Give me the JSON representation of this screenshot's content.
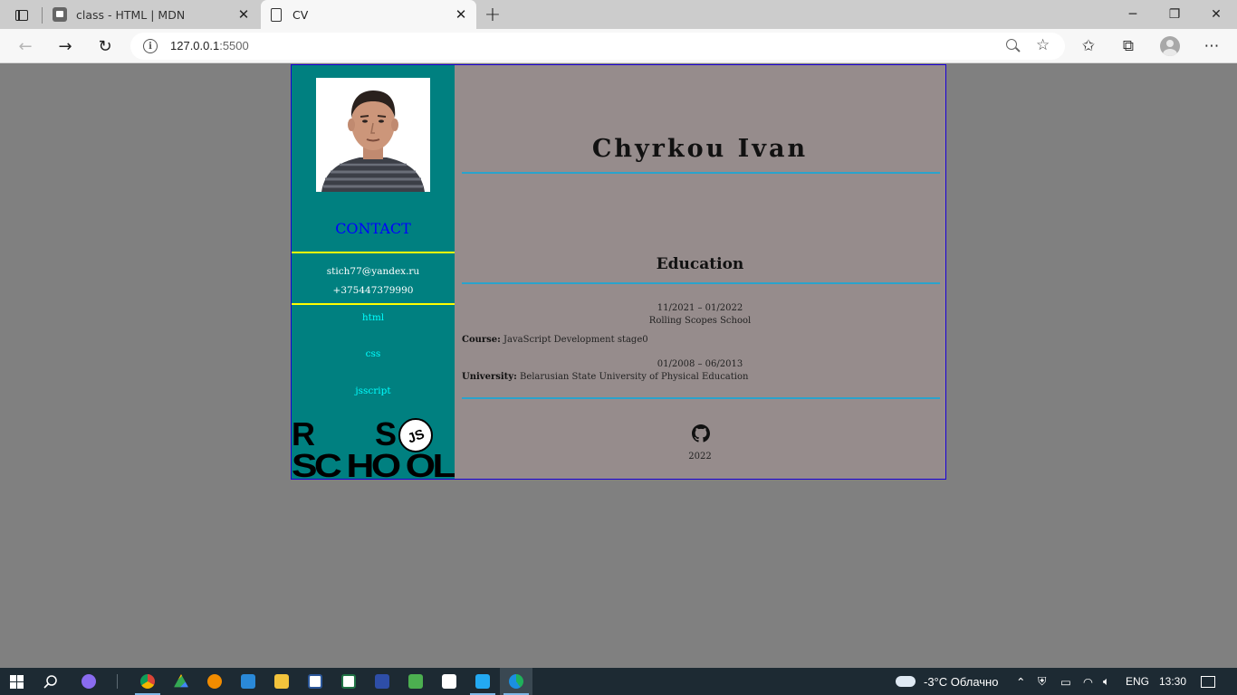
{
  "browser": {
    "tabs": [
      {
        "title": "class - HTML | MDN",
        "icon": "mdn-favicon-icon",
        "active": false
      },
      {
        "title": "CV",
        "icon": "document-icon",
        "active": true
      }
    ],
    "url_host": "127.0.0.1",
    "url_port": ":5500"
  },
  "cv": {
    "sidebar": {
      "contact_title": "CONTACT",
      "email": "stich77@yandex.ru",
      "phone": "+375447379990",
      "skills": [
        "html",
        "css",
        "jsscript"
      ],
      "logo": {
        "row1": [
          "R",
          "S"
        ],
        "row2": "SC HO OL",
        "badge": "JS"
      }
    },
    "name": "Chyrkou Ivan",
    "education": {
      "title": "Education",
      "entries": [
        {
          "date": "11/2021 – 01/2022",
          "school": "Rolling Scopes School",
          "label": "Course:",
          "value": "JavaScript Development stage0"
        },
        {
          "date": "01/2008 – 06/2013",
          "label": "University:",
          "value": "Belarusian State University of Physical Education"
        }
      ]
    },
    "footer_year": "2022"
  },
  "taskbar": {
    "weather": "-3°C Облачно",
    "language": "ENG",
    "time": "13:30"
  },
  "colors": {
    "sidebar": "#008080",
    "main": "#968c8c",
    "contact": "#0000ff",
    "divider_yellow": "#ffff00",
    "divider_blue": "#2aa3cc",
    "skills": "#00ffff",
    "page_bg": "#808080"
  }
}
